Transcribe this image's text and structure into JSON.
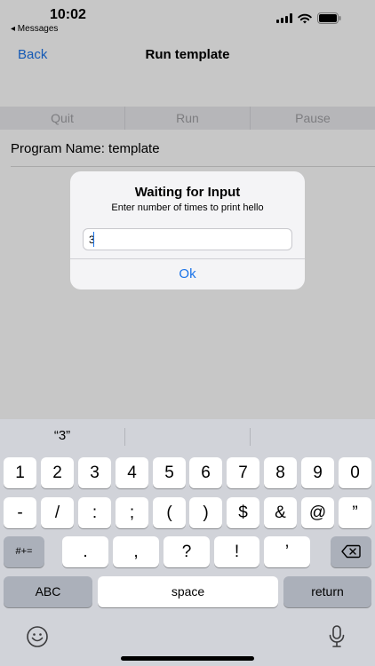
{
  "status_bar": {
    "time": "10:02",
    "back_app": "◂ Messages"
  },
  "nav": {
    "back_label": "Back",
    "title": "Run template"
  },
  "toolbar": {
    "quit": "Quit",
    "run": "Run",
    "pause": "Pause"
  },
  "program": {
    "name_label": "Program Name: template"
  },
  "alert": {
    "title": "Waiting for Input",
    "message": "Enter number of times to print hello",
    "input_value": "3",
    "ok_label": "Ok"
  },
  "keyboard": {
    "suggestions": [
      "“3”",
      "",
      ""
    ],
    "row1": [
      "1",
      "2",
      "3",
      "4",
      "5",
      "6",
      "7",
      "8",
      "9",
      "0"
    ],
    "row2": [
      "-",
      "/",
      ":",
      ";",
      "(",
      ")",
      "$",
      "&",
      "@",
      "”"
    ],
    "row3": [
      "#+=",
      ".",
      ",",
      "?",
      "!",
      "’"
    ],
    "abc_label": "ABC",
    "space_label": "space",
    "return_label": "return"
  },
  "colors": {
    "accent": "#1a73e8",
    "keyboard_bg": "#d1d3d9",
    "dim_overlay": "rgba(0,0,0,0.22)"
  },
  "icons": [
    "wifi-icon",
    "battery-icon",
    "signal-icon",
    "backspace-icon",
    "emoji-icon",
    "microphone-icon"
  ]
}
